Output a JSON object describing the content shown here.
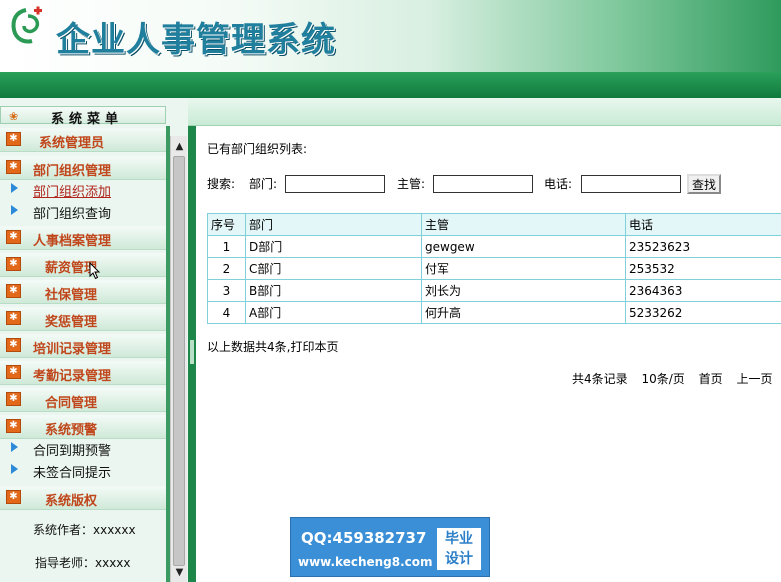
{
  "header": {
    "app_title": "企业人事管理系统"
  },
  "sidebar": {
    "menu_title": "系统菜单",
    "categories": [
      {
        "label": "系统管理员"
      },
      {
        "label": "部门组织管理",
        "subitems": [
          "部门组织添加",
          "部门组织查询"
        ]
      },
      {
        "label": "人事档案管理"
      },
      {
        "label": "薪资管理"
      },
      {
        "label": "社保管理"
      },
      {
        "label": "奖惩管理"
      },
      {
        "label": "培训记录管理"
      },
      {
        "label": "考勤记录管理"
      },
      {
        "label": "合同管理"
      },
      {
        "label": "系统预警",
        "subitems": [
          "合同到期预警",
          "未签合同提示"
        ]
      },
      {
        "label": "系统版权"
      }
    ],
    "copyright": {
      "author": "系统作者：xxxxxx",
      "teacher": "指导老师：xxxxx"
    },
    "active_item": "部门组织添加"
  },
  "main": {
    "list_title": "已有部门组织列表:",
    "search": {
      "label": "搜索:",
      "dept_label": "部门:",
      "dept_value": "",
      "manager_label": "主管:",
      "manager_value": "",
      "phone_label": "电话:",
      "phone_value": "",
      "button_label": "查找"
    },
    "table": {
      "headers": [
        "序号",
        "部门",
        "主管",
        "电话"
      ],
      "rows": [
        [
          "1",
          "D部门",
          "gewgew",
          "23523623"
        ],
        [
          "2",
          "C部门",
          "付军",
          "253532"
        ],
        [
          "3",
          "B部门",
          "刘长为",
          "2364363"
        ],
        [
          "4",
          "A部门",
          "何升高",
          "5233262"
        ]
      ]
    },
    "summary": "以上数据共4条,打印本页",
    "pager": {
      "total": "共4条记录",
      "per_page": "10条/页",
      "first": "首页",
      "prev": "上一页",
      "next": "下"
    }
  },
  "watermark": {
    "qq": "QQ:459382737",
    "url": "www.kecheng8.com",
    "badge_line1": "毕业",
    "badge_line2": "设计"
  },
  "colors": {
    "accent_green": "#1c8749",
    "category_text": "#c0461b",
    "table_border": "#7fd0d8",
    "title_blue": "#1f7f9d"
  }
}
